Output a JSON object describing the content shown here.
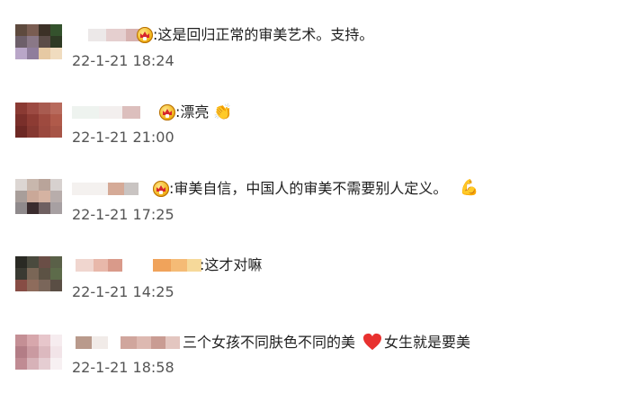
{
  "comments": [
    {
      "text": ":这是回归正常的审美艺术。支持。",
      "date": "22-1-21 18:24",
      "badge": "crown-badge-icon"
    },
    {
      "text": ":漂亮",
      "date": "22-1-21 21:00",
      "badge": "crown-badge-icon",
      "emoji": "👏"
    },
    {
      "text": ":审美自信，中国人的审美不需要别人定义。",
      "date": "22-1-21 17:25",
      "badge": "crown-badge-icon",
      "emoji": "💪"
    },
    {
      "text": ":这才对嘛",
      "date": "22-1-21 14:25"
    },
    {
      "text_a": "三个女孩不同肤色不同的美",
      "text_b": "女生就是要美",
      "date": "22-1-21 18:58",
      "emoji": "heart-icon"
    }
  ],
  "colors": {
    "text": "#1f1f1f",
    "date": "#555555",
    "heart": "#e8312f"
  }
}
